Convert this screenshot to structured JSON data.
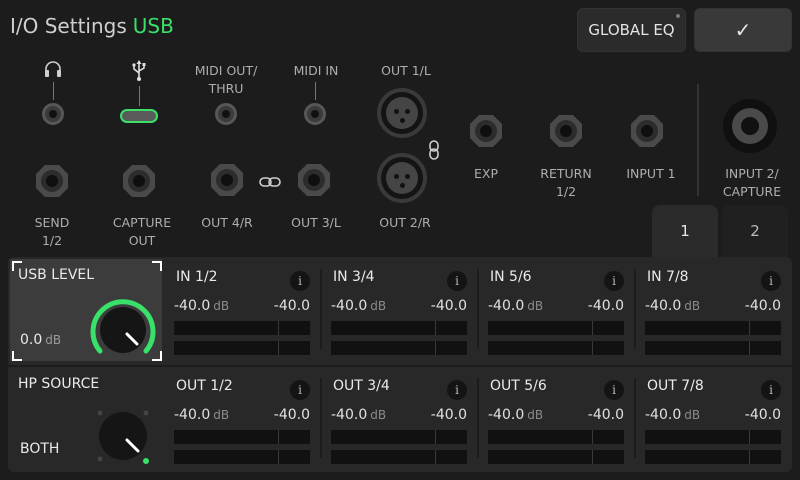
{
  "header": {
    "title": "I/O Settings",
    "mode": "USB"
  },
  "buttons": {
    "global_eq": "GLOBAL EQ",
    "confirm": "✓"
  },
  "ports": {
    "midi_out": "MIDI OUT/\nTHRU",
    "midi_in": "MIDI IN",
    "out_1l": "OUT 1/L",
    "out_2r": "OUT 2/R",
    "exp": "EXP",
    "return": "RETURN\n1/2",
    "input1": "INPUT 1",
    "input2": "INPUT 2/\nCAPTURE",
    "send": "SEND\n1/2",
    "capture_out": "CAPTURE\nOUT",
    "out_4r": "OUT 4/R",
    "out_3l": "OUT 3/L"
  },
  "tabs": [
    "1",
    "2"
  ],
  "usb_level": {
    "label": "USB LEVEL",
    "value": "0.0",
    "unit": "dB"
  },
  "hp_source": {
    "label": "HP SOURCE",
    "value": "BOTH"
  },
  "inputs": [
    {
      "name": "IN 1/2",
      "val1": "-40.0",
      "unit": "dB",
      "val2": "-40.0"
    },
    {
      "name": "IN 3/4",
      "val1": "-40.0",
      "unit": "dB",
      "val2": "-40.0"
    },
    {
      "name": "IN 5/6",
      "val1": "-40.0",
      "unit": "dB",
      "val2": "-40.0"
    },
    {
      "name": "IN 7/8",
      "val1": "-40.0",
      "unit": "dB",
      "val2": "-40.0"
    }
  ],
  "outputs": [
    {
      "name": "OUT 1/2",
      "val1": "-40.0",
      "unit": "dB",
      "val2": "-40.0"
    },
    {
      "name": "OUT 3/4",
      "val1": "-40.0",
      "unit": "dB",
      "val2": "-40.0"
    },
    {
      "name": "OUT 5/6",
      "val1": "-40.0",
      "unit": "dB",
      "val2": "-40.0"
    },
    {
      "name": "OUT 7/8",
      "val1": "-40.0",
      "unit": "dB",
      "val2": "-40.0"
    }
  ],
  "info_glyph": "i",
  "colors": {
    "accent": "#39e06a",
    "background": "#1c1c1c",
    "panel": "#272827"
  }
}
